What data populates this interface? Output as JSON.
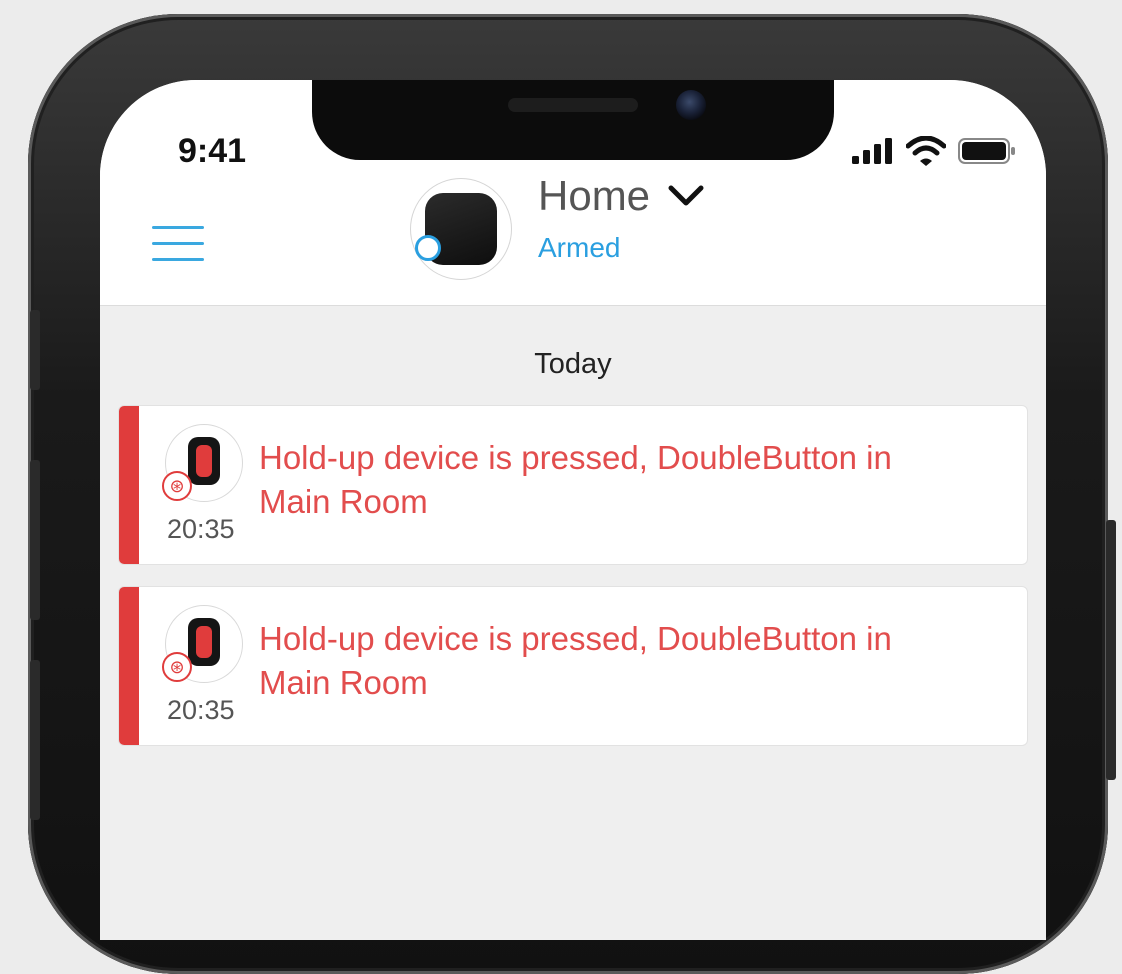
{
  "status_bar": {
    "time": "9:41",
    "signal_icon": "cellular-signal-icon",
    "wifi_icon": "wifi-icon",
    "battery_icon": "battery-icon"
  },
  "header": {
    "menu_icon": "hamburger-menu-icon",
    "hub_name": "Home",
    "hub_status": "Armed",
    "dropdown_icon": "chevron-down-icon",
    "accent_color": "#2a9fe0"
  },
  "feed": {
    "section_label": "Today",
    "alert_color": "#e03c3c",
    "events": [
      {
        "message": "Hold-up device is pressed, DoubleButton in Main Room",
        "time": "20:35"
      },
      {
        "message": "Hold-up device is pressed, DoubleButton in Main Room",
        "time": "20:35"
      }
    ]
  }
}
